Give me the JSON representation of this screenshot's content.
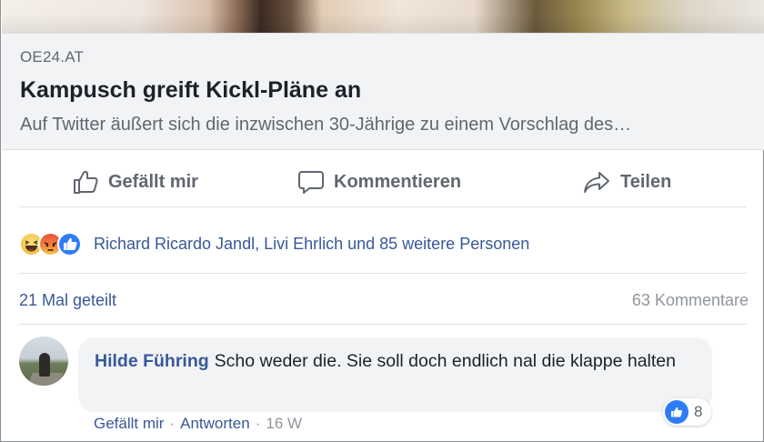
{
  "preview": {
    "domain": "OE24.AT",
    "headline": "Kampusch greift Kickl-Pläne an",
    "description": "Auf Twitter äußert sich die inzwischen 30-Jährige zu einem Vorschlag des…"
  },
  "actions": {
    "like": "Gefällt mir",
    "comment": "Kommentieren",
    "share": "Teilen"
  },
  "reactions": {
    "icons": [
      "haha-reaction-icon",
      "angry-reaction-icon",
      "like-reaction-icon"
    ],
    "summary": "Richard Ricardo Jandl, Livi Ehrlich und 85 weitere Personen"
  },
  "stats": {
    "shares": "21 Mal geteilt",
    "comments": "63 Kommentare"
  },
  "comment": {
    "author": "Hilde Führing",
    "text": "Scho weder die. Sie soll doch endlich nal die klappe halten",
    "likes": "8",
    "like_label": "Gefällt mir",
    "reply_label": "Antworten",
    "separator": "·",
    "time": "16 W"
  },
  "colors": {
    "link": "#385898",
    "secondary_text": "#606770",
    "like_blue": "#2f7df6",
    "preview_bg": "#f2f3f5"
  }
}
